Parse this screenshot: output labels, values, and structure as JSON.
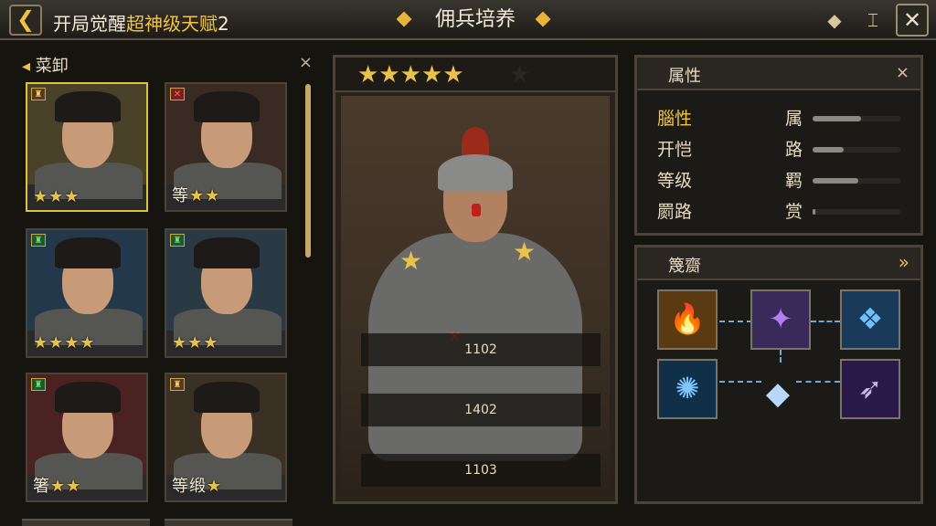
{
  "header": {
    "back_icon": "back-arrow-icon",
    "title_prefix": "开局觉醒",
    "title_highlight": "超神级天赋",
    "title_suffix": "2",
    "center_title": "佣兵培养",
    "icon_expand": "◆",
    "icon_layout": "⌶",
    "close_label": "✕"
  },
  "roster": {
    "title": "菜卸",
    "close_label": "×",
    "cards": [
      {
        "badge": "♜",
        "badge_color": "gold",
        "stars": "★★★",
        "tier_text": "",
        "selected": true,
        "bg": "#4a4228"
      },
      {
        "badge": "✕",
        "badge_color": "red",
        "stars": "★★",
        "tier_text": "等",
        "selected": false,
        "bg": "#3a2a24"
      },
      {
        "badge": "♜",
        "badge_color": "green",
        "stars": "★★★★",
        "tier_text": "",
        "selected": false,
        "bg": "#23384a"
      },
      {
        "badge": "♜",
        "badge_color": "green",
        "stars": "★★★",
        "tier_text": "",
        "selected": false,
        "bg": "#2a3a44"
      },
      {
        "badge": "♜",
        "badge_color": "green",
        "stars": "★★",
        "tier_text": "箸",
        "selected": false,
        "bg": "#4a2222"
      },
      {
        "badge": "♜",
        "badge_color": "gold",
        "stars": "★",
        "tier_text": "等缎",
        "selected": false,
        "bg": "#3a3024"
      }
    ]
  },
  "hero": {
    "stars": "★★★★★",
    "empty_star": "★",
    "stats": [
      "1102",
      "1402",
      "1103"
    ]
  },
  "attributes": {
    "title": "属性",
    "close_label": "×",
    "rows": [
      {
        "label": "腦性",
        "key": "属",
        "fill": 0.55,
        "selected": true
      },
      {
        "label": "开恺",
        "key": "路",
        "fill": 0.35,
        "selected": false
      },
      {
        "label": "等级",
        "key": "羁",
        "fill": 0.52,
        "selected": false
      },
      {
        "label": "罽路",
        "key": "赏",
        "fill": 0.03,
        "selected": false
      }
    ]
  },
  "skills": {
    "title": "篾齌",
    "more_label": "»",
    "items": [
      {
        "icon": "fire-spirit-icon",
        "glyph": "🔥",
        "bg": "#5a3a10"
      },
      {
        "icon": "arcane-tome-icon",
        "glyph": "✦",
        "bg": "#3a2a5a"
      },
      {
        "icon": "frost-shield-icon",
        "glyph": "❖",
        "bg": "#1a3a5a"
      },
      {
        "icon": "frost-nova-icon",
        "glyph": "✺",
        "bg": "#10304a"
      },
      {
        "icon": "shadow-dagger-icon",
        "glyph": "➶",
        "bg": "#2a1a4a"
      }
    ],
    "center_icon": "crystal-core-icon",
    "center_glyph": "◆"
  }
}
